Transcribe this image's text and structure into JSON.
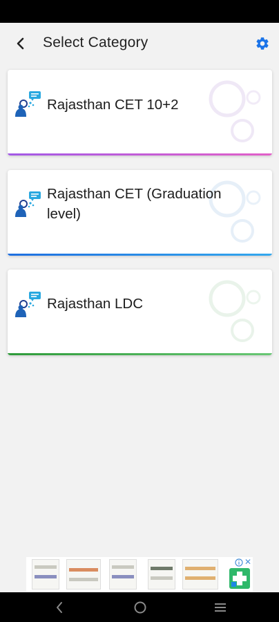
{
  "header": {
    "title": "Select Category",
    "back_icon": "back-arrow-icon",
    "settings_icon": "gear-icon",
    "accent_color": "#1a73e8"
  },
  "categories": [
    {
      "label": "Rajasthan CET 10+2",
      "accent": "#c25bd8"
    },
    {
      "label": "Rajasthan CET (Graduation level)",
      "accent": "#2b88e8"
    },
    {
      "label": "Rajasthan LDC",
      "accent": "#46b052"
    }
  ],
  "ad": {
    "info_icon": "ad-info-icon",
    "close_label": "✕"
  },
  "navigation": {
    "back_icon": "nav-back-icon",
    "home_icon": "nav-home-icon",
    "recents_icon": "nav-recents-icon"
  }
}
